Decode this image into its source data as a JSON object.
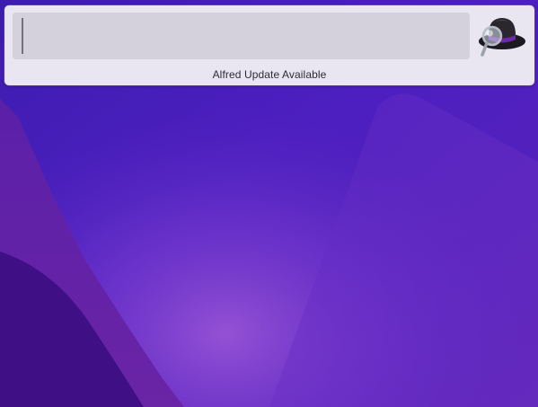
{
  "launcher": {
    "search_value": "",
    "icon": "alfred-hat-icon",
    "status_text": "Alfred Update Available"
  },
  "colors": {
    "wallpaper_base": "#4a1fb8",
    "wallpaper_light": "#7a3fd0",
    "wallpaper_dark": "#3a0f8a",
    "window_bg": "#e9e5f1",
    "search_bg": "#d4d0dc"
  }
}
